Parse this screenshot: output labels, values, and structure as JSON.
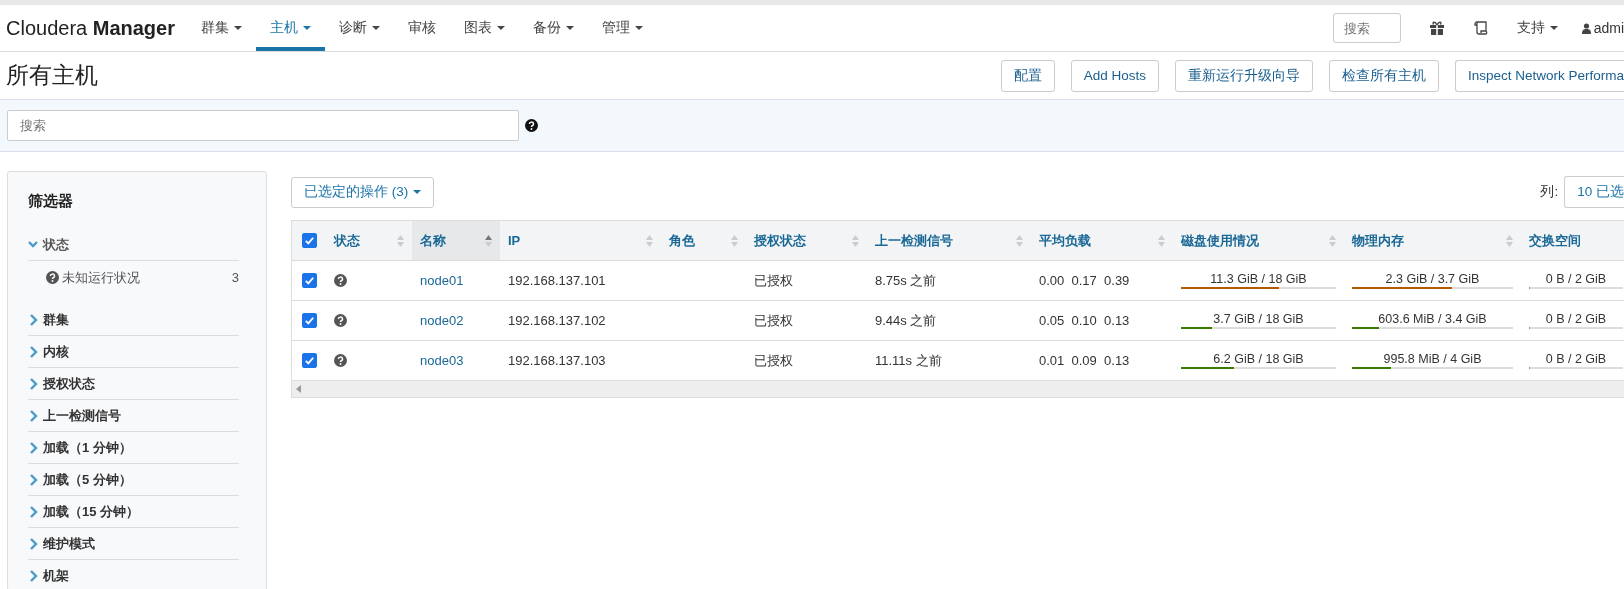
{
  "navbar": {
    "brand": "Cloudera **Manager**",
    "menu": [
      {
        "label": "群集",
        "dropdown": true,
        "selected": false
      },
      {
        "label": "主机",
        "dropdown": true,
        "selected": true
      },
      {
        "label": "诊断",
        "dropdown": true,
        "selected": false
      },
      {
        "label": "审核",
        "dropdown": false,
        "selected": false
      },
      {
        "label": "图表",
        "dropdown": true,
        "selected": false
      },
      {
        "label": "备份",
        "dropdown": true,
        "selected": false
      },
      {
        "label": "管理",
        "dropdown": true,
        "selected": false
      }
    ],
    "search": {
      "placeholder": "搜索"
    },
    "support": "支持",
    "user": "admi"
  },
  "page_title": "所有主机",
  "actions": [
    "配置",
    "Add Hosts",
    "重新运行升级向导",
    "检查所有主机",
    "Inspect Network Performa"
  ],
  "search": {
    "placeholder": "搜索"
  },
  "filters": {
    "title": "筛选器",
    "sections": [
      {
        "label": "状态",
        "expanded": true,
        "children": [
          {
            "label": "未知运行状况",
            "count": "3"
          }
        ]
      },
      {
        "label": "群集",
        "expanded": false
      },
      {
        "label": "内核",
        "expanded": false
      },
      {
        "label": "授权状态",
        "expanded": false
      },
      {
        "label": "上一检测信号",
        "expanded": false
      },
      {
        "label": "加载（1 分钟）",
        "expanded": false
      },
      {
        "label": "加载（5 分钟）",
        "expanded": false
      },
      {
        "label": "加载（15 分钟）",
        "expanded": false
      },
      {
        "label": "维护模式",
        "expanded": false
      },
      {
        "label": "机架",
        "expanded": false
      }
    ]
  },
  "selected_actions": "已选定的操作 (3)",
  "columns_label": "列:",
  "columns_select": "10 已选",
  "table": {
    "all_checked": true,
    "columns": [
      {
        "label": "状态",
        "sorted": false
      },
      {
        "label": "名称",
        "sorted": true
      },
      {
        "label": "IP",
        "sorted": false
      },
      {
        "label": "角色",
        "sorted": false
      },
      {
        "label": "授权状态",
        "sorted": false
      },
      {
        "label": "上一检测信号",
        "sorted": false
      },
      {
        "label": "平均负载",
        "sorted": false
      },
      {
        "label": "磁盘使用情况",
        "sorted": false
      },
      {
        "label": "物理内存",
        "sorted": false
      },
      {
        "label": "交换空间"
      }
    ],
    "rows": [
      {
        "checked": true,
        "name": "node01",
        "ip": "192.168.137.101",
        "auth": "已授权",
        "heartbeat": "8.75s 之前",
        "load": "0.00  0.17  0.39",
        "disk": {
          "text": "11.3 GiB / 18 GiB",
          "level": 0.63,
          "color": "#b35900"
        },
        "memory": {
          "text": "2.3 GiB / 3.7 GiB",
          "level": 0.62,
          "color": "#b35900"
        },
        "swap": {
          "text": "0 B / 2 GiB",
          "level": 0
        }
      },
      {
        "checked": true,
        "name": "node02",
        "ip": "192.168.137.102",
        "auth": "已授权",
        "heartbeat": "9.44s 之前",
        "load": "0.05  0.10  0.13",
        "disk": {
          "text": "3.7 GiB / 18 GiB",
          "level": 0.2,
          "color": "#3a7a00"
        },
        "memory": {
          "text": "603.6 MiB / 3.4 GiB",
          "level": 0.17,
          "color": "#3a7a00"
        },
        "swap": {
          "text": "0 B / 2 GiB",
          "level": 0
        }
      },
      {
        "checked": true,
        "name": "node03",
        "ip": "192.168.137.103",
        "auth": "已授权",
        "heartbeat": "11.11s 之前",
        "load": "0.01  0.09  0.13",
        "disk": {
          "text": "6.2 GiB / 18 GiB",
          "level": 0.34,
          "color": "#3a7a00"
        },
        "memory": {
          "text": "995.8 MiB / 4 GiB",
          "level": 0.24,
          "color": "#3a7a00"
        },
        "swap": {
          "text": "0 B / 2 GiB",
          "level": 0
        }
      }
    ]
  }
}
